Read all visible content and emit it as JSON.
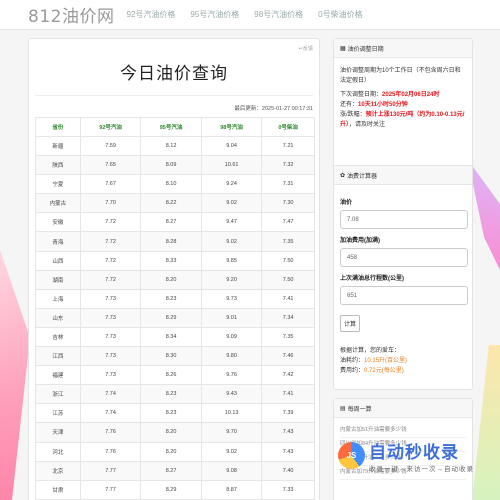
{
  "header": {
    "logo": "812油价网",
    "nav": [
      "92号汽油价格",
      "95号汽油价格",
      "98号汽油价格",
      "0号柴油价格"
    ]
  },
  "main": {
    "feedback": "↩反馈",
    "title": "今日油价查询",
    "update_time": "最后更新：2025-01-27 00:17:31",
    "columns": [
      "省份",
      "92号汽油",
      "95号汽油",
      "98号汽油",
      "0号柴油"
    ],
    "rows": [
      [
        "新疆",
        "7.59",
        "8.12",
        "9.04",
        "7.21"
      ],
      [
        "陕西",
        "7.65",
        "8.09",
        "10.61",
        "7.32"
      ],
      [
        "宁夏",
        "7.67",
        "8.10",
        "9.24",
        "7.31"
      ],
      [
        "内蒙古",
        "7.70",
        "8.22",
        "9.02",
        "7.30"
      ],
      [
        "安徽",
        "7.72",
        "8.27",
        "9.47",
        "7.47"
      ],
      [
        "青海",
        "7.72",
        "8.28",
        "9.02",
        "7.35"
      ],
      [
        "山西",
        "7.72",
        "8.33",
        "9.85",
        "7.50"
      ],
      [
        "湖南",
        "7.72",
        "8.20",
        "9.20",
        "7.50"
      ],
      [
        "上海",
        "7.73",
        "8.23",
        "9.73",
        "7.41"
      ],
      [
        "山东",
        "7.73",
        "8.29",
        "9.01",
        "7.34"
      ],
      [
        "吉林",
        "7.73",
        "8.34",
        "9.09",
        "7.35"
      ],
      [
        "江西",
        "7.73",
        "8.30",
        "9.80",
        "7.46"
      ],
      [
        "福建",
        "7.73",
        "8.26",
        "9.76",
        "7.42"
      ],
      [
        "浙江",
        "7.74",
        "8.23",
        "9.43",
        "7.41"
      ],
      [
        "江苏",
        "7.74",
        "8.23",
        "10.13",
        "7.39"
      ],
      [
        "天津",
        "7.76",
        "8.20",
        "9.70",
        "7.43"
      ],
      [
        "河北",
        "7.76",
        "8.20",
        "9.02",
        "7.43"
      ],
      [
        "北京",
        "7.77",
        "8.27",
        "9.08",
        "7.40"
      ],
      [
        "甘肃",
        "7.77",
        "8.29",
        "8.87",
        "7.33"
      ],
      [
        "湖北",
        "7.78",
        "8.33",
        "9.53",
        "7.42"
      ]
    ]
  },
  "adjust": {
    "heading": "油价调整日期",
    "line1": "油价调整周期为10个工作日（不包含周六日和法定假日）",
    "next_label": "下次调整日期：",
    "next_date": "2025年02月06日24时",
    "countdown_label": "还有：",
    "countdown": "10天11小时50分钟",
    "trend_label": "涨/跌幅：",
    "trend": "预计上涨130元/吨（约为0.10-0.13元/升）",
    "note": "，请及时关注"
  },
  "calculator": {
    "heading": "油费计算器",
    "price_label": "油价",
    "price_value": "7.08",
    "cost_label": "加油费用(加满)",
    "cost_value": "458",
    "distance_label": "上次满油总行程数(公里)",
    "distance_value": "651",
    "button": "计算",
    "result_intro": "根据计算，您的爱车：",
    "per_km_label": "油耗约：",
    "per_km_value": "10.15升(百公里)",
    "cost_km_label": "费用约：",
    "cost_km_value": "0.72元(每公里)"
  },
  "weekly": {
    "heading": "每周一算",
    "items": [
      "内蒙古加51升油需要多少钱",
      "四川省加84升油需要多少钱",
      "新疆加69升油需要多少钱",
      "内蒙古加79升油需要多少钱"
    ]
  },
  "watermark": {
    "logo_text": "JS",
    "title": "自动秒收录",
    "subtitle": "收录一键→来访一次→自动收录"
  }
}
